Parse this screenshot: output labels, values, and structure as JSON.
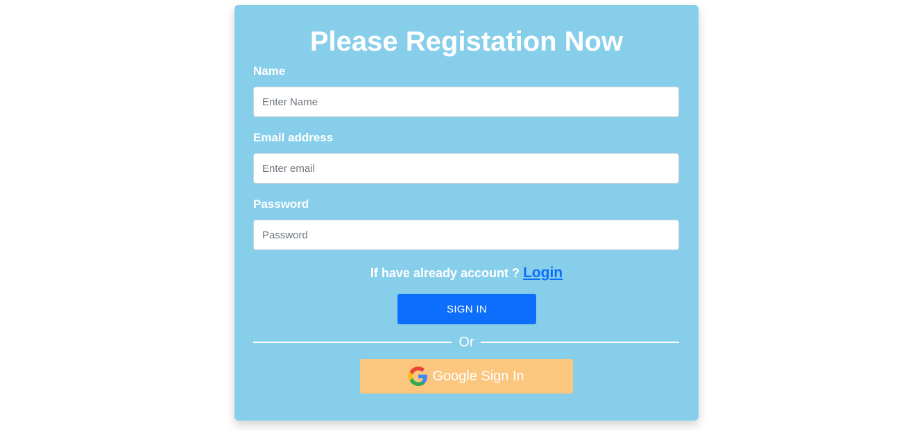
{
  "form": {
    "title": "Please Registation Now",
    "fields": [
      {
        "label": "Name",
        "placeholder": "Enter Name",
        "value": ""
      },
      {
        "label": "Email address",
        "placeholder": "Enter email",
        "value": ""
      },
      {
        "label": "Password",
        "placeholder": "Password",
        "value": ""
      }
    ],
    "account_prompt": "If have already account ?",
    "login_link": "Login",
    "signin_button": "SIGN IN",
    "divider_text": "Or",
    "google_button": "Google Sign In"
  },
  "colors": {
    "card_background": "#87ceeb",
    "primary": "#0d6efd",
    "google_button": "#fbc67e",
    "text": "#ffffff"
  },
  "icons": {
    "google": "google-logo-icon"
  }
}
